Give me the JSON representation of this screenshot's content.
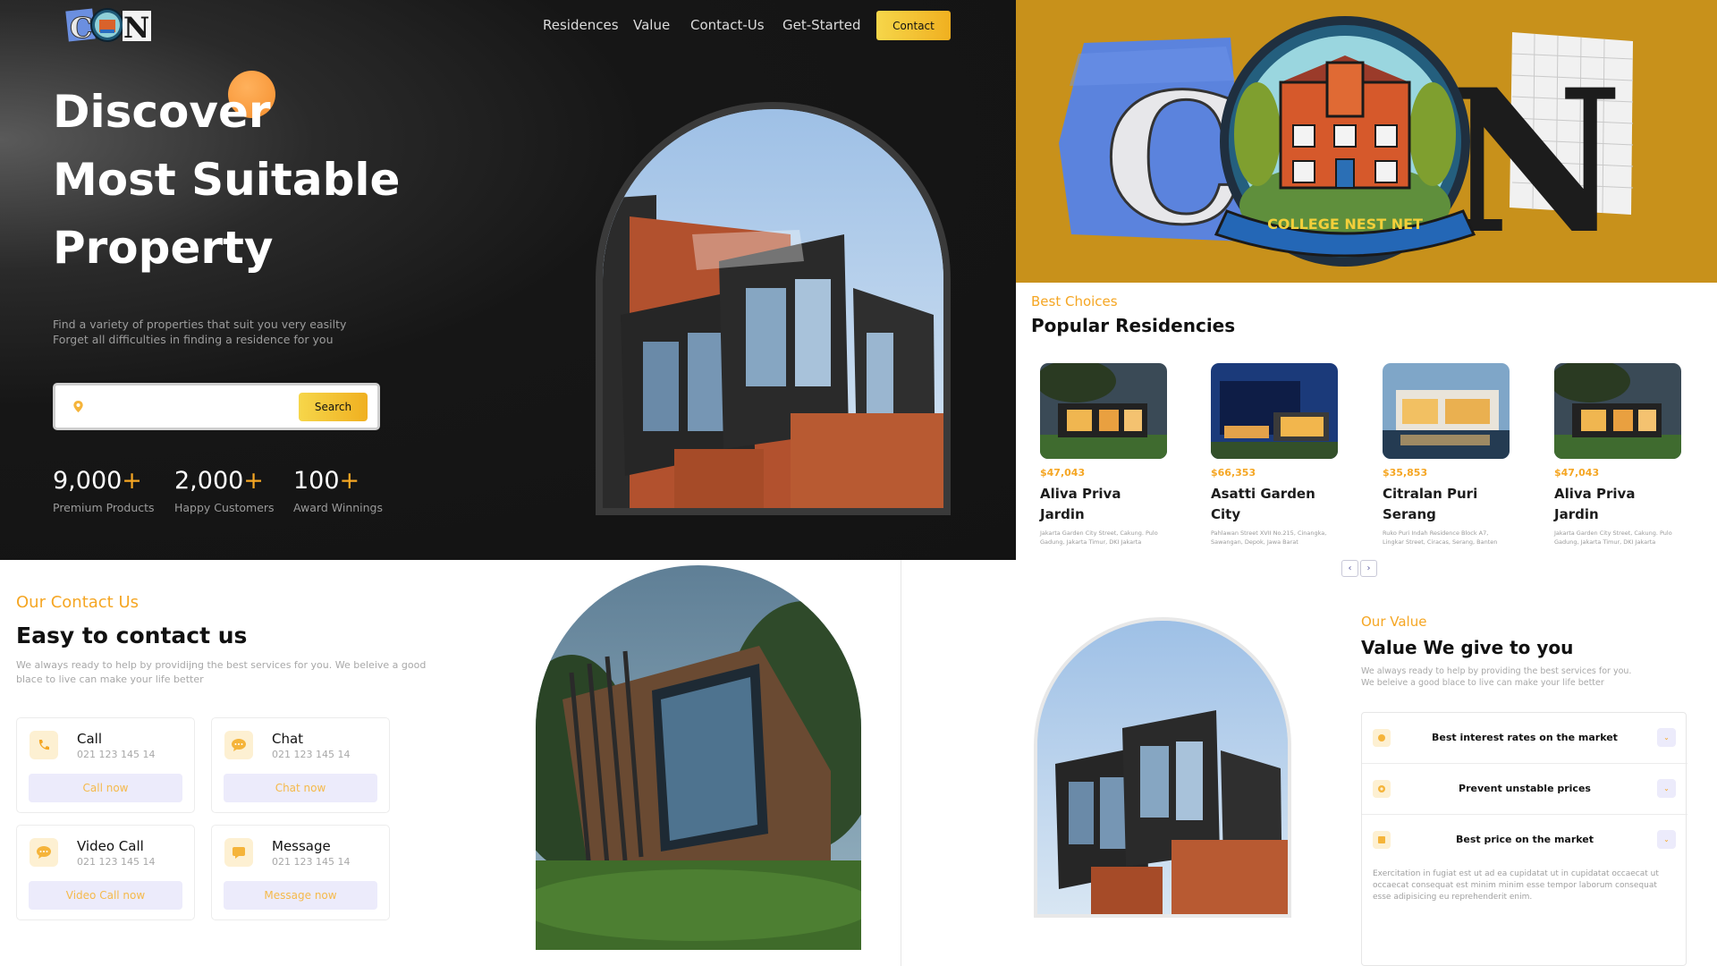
{
  "nav": {
    "links": [
      "Residences",
      "Value",
      "Contact-Us",
      "Get-Started"
    ],
    "contact_label": "Contact"
  },
  "hero": {
    "title_lines": [
      "Discover",
      "Most Suitable",
      "Property"
    ],
    "subtitle_lines": [
      "Find a variety of properties that suit you very easilty",
      "Forget all difficulties in finding a residence for you"
    ],
    "search_placeholder": "",
    "search_label": "Search",
    "stats": [
      {
        "number": "9,000",
        "plus": "+",
        "label": "Premium Products"
      },
      {
        "number": "2,000",
        "plus": "+",
        "label": "Happy Customers"
      },
      {
        "number": "100",
        "plus": "+",
        "label": "Award Winnings"
      }
    ]
  },
  "logo": {
    "letter_left": "C",
    "letter_right": "N",
    "banner": "COLLEGE NEST NET"
  },
  "popular": {
    "kicker": "Best Choices",
    "title": "Popular Residencies",
    "cards": [
      {
        "currency": "$",
        "price": "47,043",
        "name_lines": [
          "Aliva Priva Jardin"
        ],
        "address_lines": [
          "Jakarta Garden City Street, Cakung. Pulo",
          "Gadung, Jakarta Timur, DKI Jakarta"
        ]
      },
      {
        "currency": "$",
        "price": "66,353",
        "name_lines": [
          "Asatti Garden City"
        ],
        "address_lines": [
          "Pahlawan Street XVII No.215, Cinangka,",
          "Sawangan, Depok, Jawa Barat"
        ]
      },
      {
        "currency": "$",
        "price": "35,853",
        "name_lines": [
          "Citralan Puri",
          "Serang"
        ],
        "address_lines": [
          "Ruko Puri Indah Residence Block A7,",
          "Lingkar Street, Ciracas, Serang, Banten"
        ]
      },
      {
        "currency": "$",
        "price": "47,043",
        "name_lines": [
          "Aliva Priva Jardin"
        ],
        "address_lines": [
          "Jakarta Garden City Street, Cakung. Pulo",
          "Gadung, Jakarta Timur, DKI Jakarta"
        ]
      }
    ],
    "prev_label": "‹",
    "next_label": "›"
  },
  "contact": {
    "kicker": "Our Contact Us",
    "title": "Easy to contact us",
    "desc": "We always ready to help by providijng the best services for you. We beleive a good blace to live can make your life better",
    "cards": [
      {
        "title": "Call",
        "number": "021 123 145 14",
        "button": "Call now",
        "icon": "phone-icon"
      },
      {
        "title": "Chat",
        "number": "021 123 145 14",
        "button": "Chat now",
        "icon": "chat-icon"
      },
      {
        "title": "Video Call",
        "number": "021 123 145 14",
        "button": "Video Call now",
        "icon": "video-call-icon"
      },
      {
        "title": "Message",
        "number": "021 123 145 14",
        "button": "Message now",
        "icon": "message-icon"
      }
    ]
  },
  "value": {
    "kicker": "Our Value",
    "title": "Value We give to you",
    "desc_lines": [
      "We always ready to help by providing the best services for you.",
      "We beleive a good blace to live can make your life better"
    ],
    "items": [
      {
        "label": "Best interest rates on the market",
        "expanded": false
      },
      {
        "label": "Prevent unstable prices",
        "expanded": false
      },
      {
        "label": "Best price on the market",
        "expanded": true,
        "body": "Exercitation in fugiat est ut ad ea cupidatat ut in cupidatat occaecat ut occaecat consequat est minim minim esse tempor laborum consequat esse adipisicing eu reprehenderit enim."
      }
    ],
    "toggle_symbol": "⌄"
  },
  "colors": {
    "accent": "#f5a623",
    "button_yellow": "#f0c030",
    "hero_bg": "#141414",
    "logo_panel_bg": "#c8911b",
    "soft_lavender": "#ecebfb"
  }
}
